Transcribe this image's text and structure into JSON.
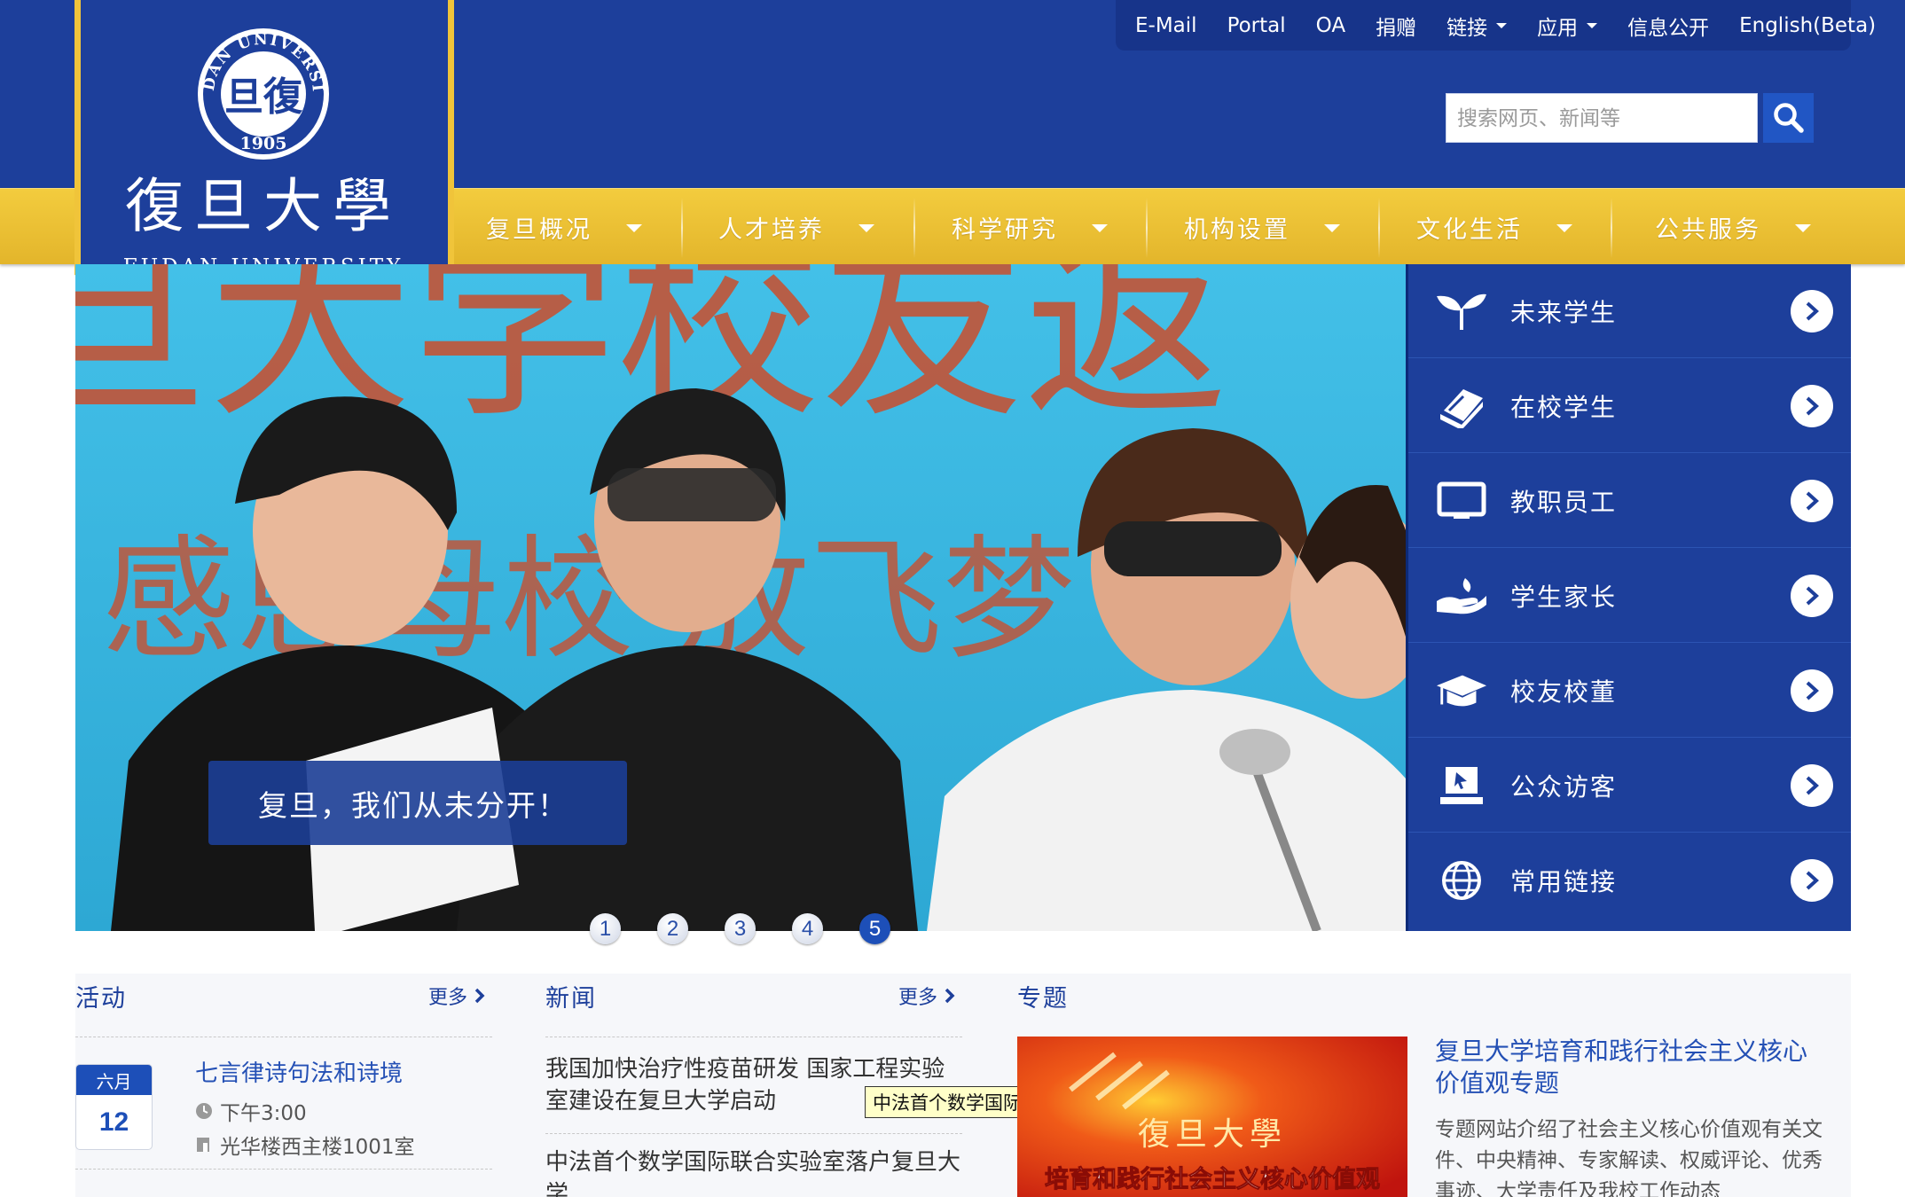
{
  "logo": {
    "seal_lettering": [
      "FUDAN UNIVERSITY",
      "1905"
    ],
    "name_chinese": "復旦大學",
    "name_english": "FUDAN UNIVERSITY"
  },
  "topbar": {
    "links": [
      {
        "label": "E-Mail",
        "dropdown": false
      },
      {
        "label": "Portal",
        "dropdown": false
      },
      {
        "label": "OA",
        "dropdown": false
      },
      {
        "label": "捐赠",
        "dropdown": false
      },
      {
        "label": "链接",
        "dropdown": true
      },
      {
        "label": "应用",
        "dropdown": true
      },
      {
        "label": "信息公开",
        "dropdown": false
      },
      {
        "label": "English(Beta)",
        "dropdown": false
      }
    ]
  },
  "search": {
    "placeholder": "搜索网页、新闻等",
    "icon": "search-icon"
  },
  "nav": {
    "items": [
      "复旦概况",
      "人才培养",
      "科学研究",
      "机构设置",
      "文化生活",
      "公共服务"
    ]
  },
  "hero": {
    "banner_text": "旦大学校友返",
    "banner_text_2": "感恩母校 放飞梦",
    "caption": "复旦，我们从未分开！",
    "slides": [
      "1",
      "2",
      "3",
      "4",
      "5"
    ],
    "active_slide": 5
  },
  "sidemenu": {
    "items": [
      {
        "label": "未来学生",
        "icon": "sprout-icon"
      },
      {
        "label": "在校学生",
        "icon": "book-icon"
      },
      {
        "label": "教职员工",
        "icon": "monitor-icon"
      },
      {
        "label": "学生家长",
        "icon": "hands-icon"
      },
      {
        "label": "校友校董",
        "icon": "graduation-cap-icon"
      },
      {
        "label": "公众访客",
        "icon": "kiosk-icon"
      },
      {
        "label": "常用链接",
        "icon": "globe-icon"
      }
    ]
  },
  "activities": {
    "title": "活动",
    "more": "更多",
    "event": {
      "month": "六月",
      "day": "12",
      "title": "七言律诗句法和诗境",
      "time": "下午3:00",
      "place": "光华楼西主楼1001室"
    }
  },
  "news": {
    "title": "新闻",
    "more": "更多",
    "items": [
      "我国加快治疗性疫苗研发 国家工程实验室建设在复旦大学启动",
      "中法首个数学国际联合实验室落户复旦大学"
    ],
    "tooltip": "中法首个数学国际联合实验室落户复旦大学"
  },
  "topics": {
    "title": "专题",
    "image_text_1": "復旦大學",
    "image_text_2": "培育和践行社会主义核心价值观",
    "headline": "复旦大学培育和践行社会主义核心价值观专题",
    "description": "专题网站介绍了社会主义核心价值观有关文件、中央精神、专家解读、权威评论、优秀事迹、大学责任及我校工作动态"
  },
  "colors": {
    "primary_blue": "#1d3f9b",
    "gold": "#f0c43a",
    "link_blue": "#2450b5"
  }
}
